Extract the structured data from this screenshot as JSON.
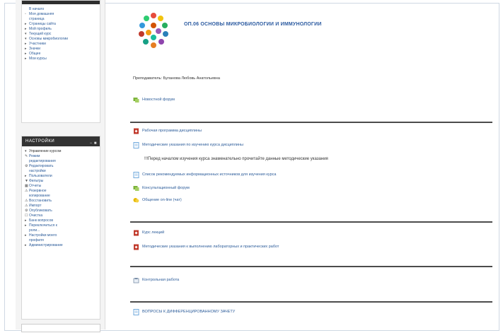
{
  "sidebar": {
    "nav": {
      "items": [
        {
          "label": "В начало",
          "glyph": "",
          "dark": false
        },
        {
          "label": "Моя домашняя",
          "glyph": "▫",
          "dark": false
        },
        {
          "label": "страница",
          "glyph": "",
          "dark": false
        },
        {
          "label": "Страницы сайта",
          "glyph": "▸",
          "dark": false
        },
        {
          "label": "Мой профиль",
          "glyph": "▸",
          "dark": false
        },
        {
          "label": "Текущий курс",
          "glyph": "▾",
          "dark": false
        },
        {
          "label": "Основы микробиологии",
          "glyph": "▾",
          "dark": false
        },
        {
          "label": "Участники",
          "glyph": "▸",
          "dark": false
        },
        {
          "label": "Значки",
          "glyph": "▸",
          "dark": false
        },
        {
          "label": "Общее",
          "glyph": "▸",
          "dark": false
        },
        {
          "label": "Мои курсы",
          "glyph": "▸",
          "dark": false
        }
      ]
    },
    "settings": {
      "title": "НАСТРОЙКИ",
      "items": [
        {
          "label": "Управление курсом",
          "glyph": "▾",
          "dark": true
        },
        {
          "label": "Режим",
          "glyph": "✎",
          "dark": false
        },
        {
          "label": "редактирования",
          "glyph": "",
          "dark": false
        },
        {
          "label": "Редактировать",
          "glyph": "⚙",
          "dark": false
        },
        {
          "label": "настройки",
          "glyph": "",
          "dark": false
        },
        {
          "label": "Пользователи",
          "glyph": "▸",
          "dark": false
        },
        {
          "label": "Фильтры",
          "glyph": "▼",
          "dark": false
        },
        {
          "label": "Отчеты",
          "glyph": "▦",
          "dark": false
        },
        {
          "label": "Резервное",
          "glyph": "⚠",
          "dark": false
        },
        {
          "label": "копирование",
          "glyph": "",
          "dark": false
        },
        {
          "label": "Восстановить",
          "glyph": "⚠",
          "dark": false
        },
        {
          "label": "Импорт",
          "glyph": "⚠",
          "dark": false
        },
        {
          "label": "Опубликовать",
          "glyph": "⚙",
          "dark": false
        },
        {
          "label": "Очистка",
          "glyph": "☐",
          "dark": false
        },
        {
          "label": "Банк вопросов",
          "glyph": "▸",
          "dark": false
        },
        {
          "label": "Переключиться к",
          "glyph": "▸",
          "dark": false
        },
        {
          "label": "роли...",
          "glyph": "",
          "dark": false
        },
        {
          "label": "Настройки моего",
          "glyph": "▸",
          "dark": false
        },
        {
          "label": "профиля",
          "glyph": "",
          "dark": false
        },
        {
          "label": "Администрирование",
          "glyph": "▸",
          "dark": false
        }
      ]
    }
  },
  "course": {
    "title": "ОП.06 ОСНОВЫ МИКРОБИОЛОГИИ И ИММУНОЛОГИИ",
    "teacher": "Преподаватель: Буланова Любовь Анатольевна",
    "news_forum": "Новостной форум",
    "sections": {
      "s1": {
        "program": "Рабочая программа дисциплины",
        "methodical": "Методические указания по изучению курса дисциплины",
        "note": "!!!Перед началом изучения курса знаменательно прочитайте данные методические указания",
        "literature": "Список рекомендуемых информационных источников для изучения курса",
        "consult_forum": "Консультационный форум",
        "chat": "Общение on-line (чат)"
      },
      "s2": {
        "lectures": "Курс лекций",
        "lab_guide": "Методические указания к выполнению лабораторных и практических работ"
      },
      "s3": {
        "control": "Контрольная работа"
      },
      "s4": {
        "questions": "ВОПРОСЫ К ДИФФЕРЕНЦИРОВАННОМУ ЗАЧЕТУ"
      }
    }
  },
  "colors": {
    "link": "#2c5c9a",
    "title": "#2b5aa0",
    "pdf_icon": "#c0392b",
    "forum_icon": "#7bb33a",
    "doc_icon": "#6fa8dc"
  }
}
